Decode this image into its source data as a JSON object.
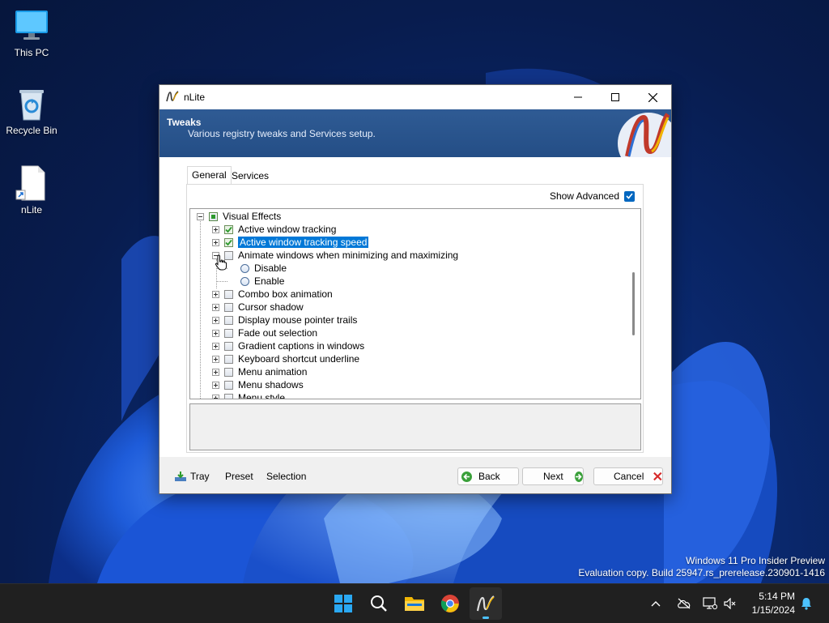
{
  "desktop": {
    "icons": [
      {
        "label": "This PC"
      },
      {
        "label": "Recycle Bin"
      },
      {
        "label": "nLite"
      }
    ],
    "watermark": {
      "line1": "Windows 11 Pro Insider Preview",
      "line2": "Evaluation copy. Build 25947.rs_prerelease.230901-1416"
    }
  },
  "window": {
    "title": "nLite",
    "header": {
      "title": "Tweaks",
      "subtitle": "Various registry tweaks and Services setup."
    },
    "tabs": [
      {
        "label": "General",
        "active": true
      },
      {
        "label": "Services",
        "active": false
      }
    ],
    "show_advanced": {
      "label": "Show Advanced",
      "checked": true
    },
    "tree": {
      "root": {
        "label": "Visual Effects",
        "state": "partial"
      },
      "items": [
        {
          "label": "Active window tracking",
          "checked": true
        },
        {
          "label": "Active window tracking speed",
          "checked": true,
          "selected": true
        },
        {
          "label": "Animate windows when minimizing and maximizing",
          "checked": false,
          "expanded": true,
          "options": [
            "Disable",
            "Enable"
          ]
        },
        {
          "label": "Combo box animation",
          "checked": false
        },
        {
          "label": "Cursor shadow",
          "checked": false
        },
        {
          "label": "Display mouse pointer trails",
          "checked": false
        },
        {
          "label": "Fade out selection",
          "checked": false
        },
        {
          "label": "Gradient captions in windows",
          "checked": false
        },
        {
          "label": "Keyboard shortcut underline",
          "checked": false
        },
        {
          "label": "Menu animation",
          "checked": false
        },
        {
          "label": "Menu shadows",
          "checked": false
        },
        {
          "label": "Menu style",
          "checked": false
        }
      ]
    },
    "footer": {
      "tray": "Tray",
      "preset": "Preset",
      "selection": "Selection",
      "back": "Back",
      "next": "Next",
      "cancel": "Cancel"
    }
  },
  "taskbar": {
    "apps": [
      "start-icon",
      "search-icon",
      "file-explorer-icon",
      "chrome-icon",
      "nlite-icon"
    ],
    "clock": {
      "time": "5:14 PM",
      "date": "1/15/2024"
    }
  },
  "colors": {
    "accent": "#0078d7",
    "header": "#2a5690",
    "taskbar": "#202020",
    "check_green": "#2c9a2c"
  }
}
